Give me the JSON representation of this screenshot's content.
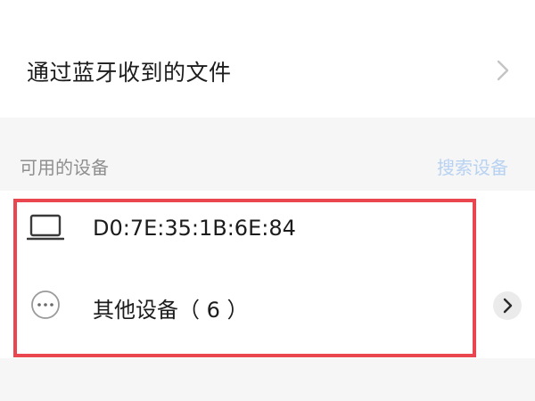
{
  "received_files": {
    "label": "通过蓝牙收到的文件",
    "icon": "chevron-right-icon"
  },
  "available_devices": {
    "section_title": "可用的设备",
    "search_label": "搜索设备",
    "search_color": "#b8d2f2",
    "devices": [
      {
        "name": "D0:7E:35:1B:6E:84",
        "icon": "laptop-icon"
      },
      {
        "name": "其他设备（ 6 ）",
        "icon": "more-dots-icon"
      }
    ]
  },
  "highlight_color": "#e9464f"
}
